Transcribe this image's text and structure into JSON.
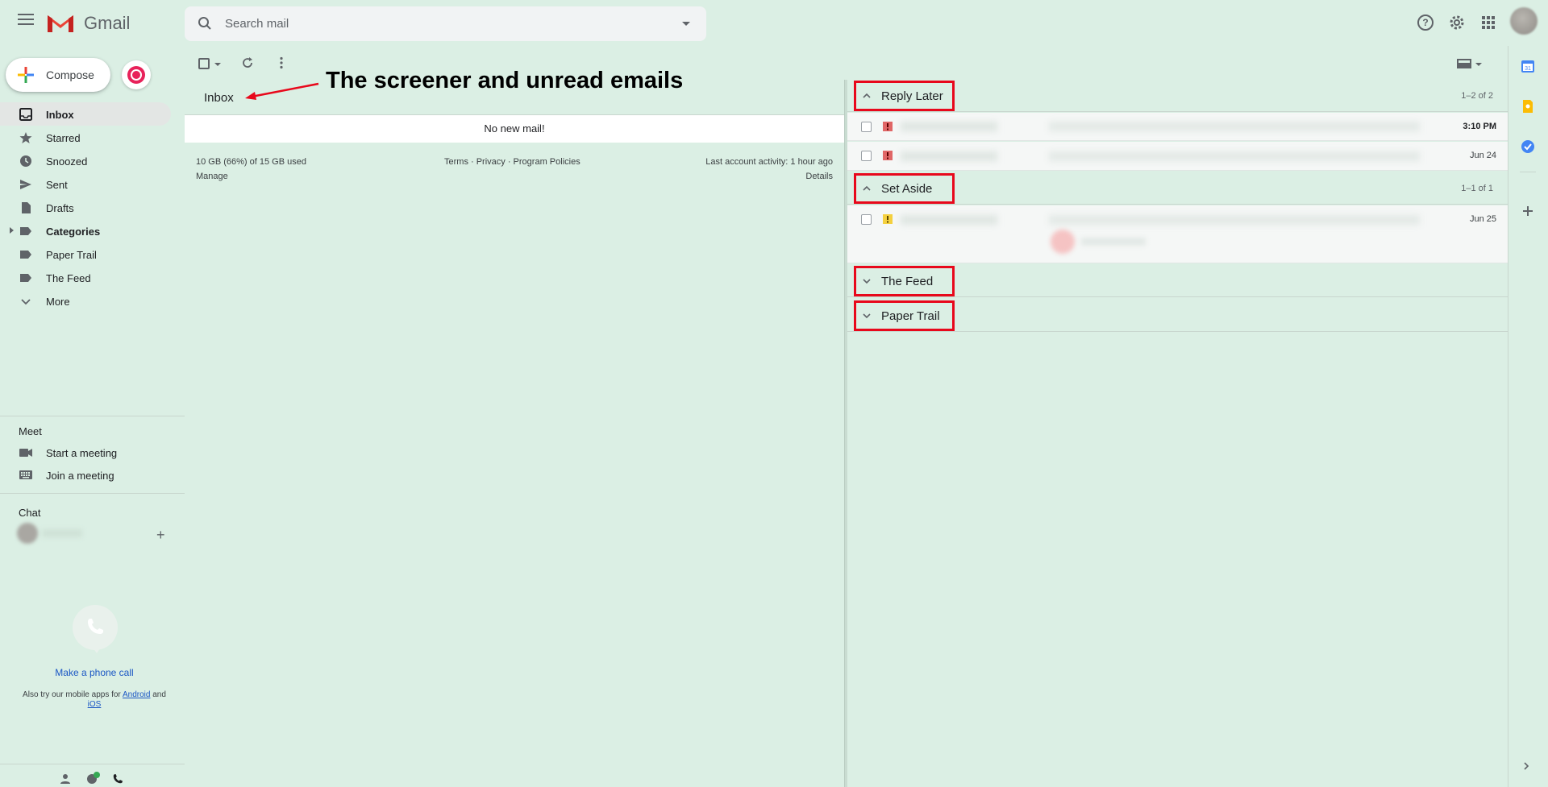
{
  "header": {
    "app_name": "Gmail",
    "search_placeholder": "Search mail",
    "icons": [
      "menu-icon",
      "help-icon",
      "settings-icon",
      "apps-icon",
      "account-avatar"
    ]
  },
  "nav": {
    "compose_label": "Compose",
    "items": [
      {
        "label": "Inbox",
        "icon": "inbox-icon",
        "active": true
      },
      {
        "label": "Starred",
        "icon": "star-icon"
      },
      {
        "label": "Snoozed",
        "icon": "clock-icon"
      },
      {
        "label": "Sent",
        "icon": "send-icon"
      },
      {
        "label": "Drafts",
        "icon": "draft-icon"
      },
      {
        "label": "Categories",
        "icon": "label-icon",
        "bold": true
      },
      {
        "label": "Paper Trail",
        "icon": "label-icon"
      },
      {
        "label": "The Feed",
        "icon": "label-icon"
      },
      {
        "label": "More",
        "icon": "chevron-down-icon"
      }
    ],
    "meet_title": "Meet",
    "meet_items": [
      {
        "label": "Start a meeting",
        "icon": "video-icon"
      },
      {
        "label": "Join a meeting",
        "icon": "keyboard-icon"
      }
    ],
    "chat_title": "Chat",
    "make_call": "Make a phone call",
    "mobile_note_pre": "Also try our mobile apps for",
    "mobile_android": "Android",
    "mobile_and": "and",
    "mobile_ios": "iOS"
  },
  "inbox_pane": {
    "title": "Inbox",
    "empty_message": "No new mail!",
    "storage": "10 GB (66%) of 15 GB used",
    "manage": "Manage",
    "links": "Terms · Privacy · Program Policies",
    "last_activity": "Last account activity: 1 hour ago",
    "details": "Details"
  },
  "annotation": {
    "text": "The screener and unread emails"
  },
  "sections": [
    {
      "label": "Reply Later",
      "count": "1–2 of 2",
      "expanded": true
    },
    {
      "label": "Set Aside",
      "count": "1–1 of 1",
      "expanded": true
    },
    {
      "label": "The Feed",
      "count": "",
      "expanded": false
    },
    {
      "label": "Paper Trail",
      "count": "",
      "expanded": false
    }
  ],
  "emails": {
    "reply_later": [
      {
        "date": "3:10 PM",
        "unread": true,
        "importance": "red"
      },
      {
        "date": "Jun 24",
        "unread": false,
        "importance": "red"
      }
    ],
    "set_aside": [
      {
        "date": "Jun 25",
        "unread": false,
        "importance": "yellow"
      }
    ]
  },
  "colors": {
    "background": "#dbefe4",
    "annotation_box": "#e8081b",
    "importance_red": "#e06666",
    "importance_yellow": "#f4d03f",
    "link": "#1a56c4"
  }
}
